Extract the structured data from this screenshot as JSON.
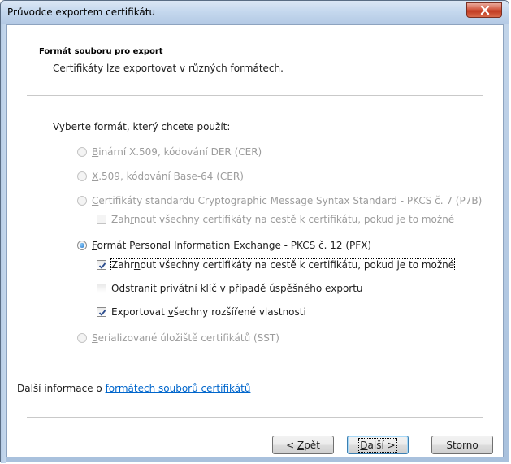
{
  "window": {
    "title": "Průvodce exportem certifikátu"
  },
  "header": {
    "title": "Formát souboru pro export",
    "subtitle": "Certifikáty lze exportovat v různých formátech."
  },
  "prompt": "Vyberte formát, který chcete použít:",
  "options": {
    "der": {
      "mnemonic": "B",
      "rest": "inární X.509, kódování DER (CER)",
      "selected": false,
      "enabled": false
    },
    "base64": {
      "mnemonic": "X",
      "rest": ".509, kódování Base-64 (CER)",
      "selected": false,
      "enabled": false
    },
    "pkcs7": {
      "mnemonic": "C",
      "rest": "ertifikáty standardu Cryptographic Message Syntax Standard - PKCS č. 7 (P7B)",
      "selected": false,
      "enabled": false
    },
    "pkcs7_include": {
      "pre": "Zah",
      "mnemonic": "r",
      "rest": "nout všechny certifikáty na cestě k certifikátu, pokud je to možné",
      "checked": false,
      "enabled": false
    },
    "pfx": {
      "mnemonic": "F",
      "rest": "ormát Personal Information Exchange - PKCS č. 12 (PFX)",
      "selected": true,
      "enabled": true
    },
    "pfx_include": {
      "pre": "Zahr",
      "mnemonic": "n",
      "rest": "out všechny certifikáty na cestě k certifikátu, pokud je to možné",
      "checked": true,
      "enabled": true
    },
    "pfx_delete_key": {
      "pre": "Odstranit privátní ",
      "mnemonic": "k",
      "rest": "líč v případě úspěšného exportu",
      "checked": false,
      "enabled": true
    },
    "pfx_export_props": {
      "pre": "Exportovat ",
      "mnemonic": "v",
      "rest": "šechny rozšířené vlastnosti",
      "checked": true,
      "enabled": true
    },
    "sst": {
      "mnemonic": "S",
      "rest": "erializované úložiště certifikátů (SST)",
      "selected": false,
      "enabled": false
    }
  },
  "more_info": {
    "text": "Další informace o ",
    "link": "formátech souborů certifikátů"
  },
  "buttons": {
    "back": {
      "pre": "< ",
      "mnemonic": "Z",
      "rest": "pět"
    },
    "next": {
      "pre": "",
      "mnemonic": "D",
      "rest": "alší >"
    },
    "cancel": {
      "label": "Storno"
    }
  },
  "colors": {
    "link": "#0066cc",
    "disabled_text": "#9c9c9c",
    "close_button": "#c0391f"
  }
}
